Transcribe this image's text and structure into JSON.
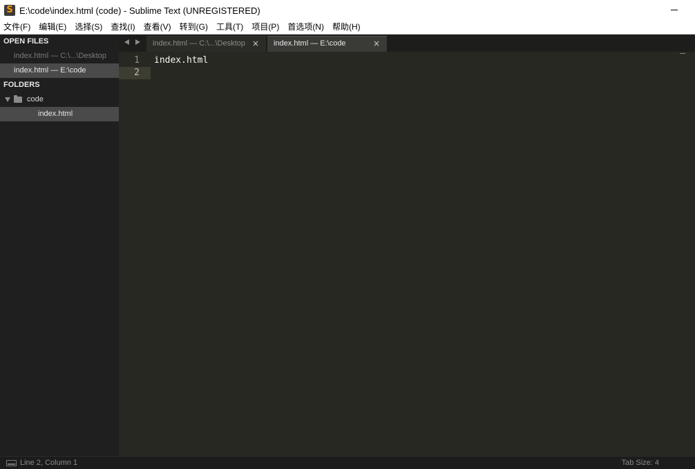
{
  "window": {
    "title": "E:\\code\\index.html (code) - Sublime Text (UNREGISTERED)",
    "icon": "sublime-text-icon"
  },
  "menu": [
    {
      "label": "文件(F)"
    },
    {
      "label": "编辑(E)"
    },
    {
      "label": "选择(S)"
    },
    {
      "label": "查找(I)"
    },
    {
      "label": "查看(V)"
    },
    {
      "label": "转到(G)"
    },
    {
      "label": "工具(T)"
    },
    {
      "label": "项目(P)"
    },
    {
      "label": "首选项(N)"
    },
    {
      "label": "帮助(H)"
    }
  ],
  "sidebar": {
    "open_files_header": "OPEN FILES",
    "open_files": [
      {
        "label": "index.html — C:\\...\\Desktop",
        "active": false
      },
      {
        "label": "index.html — E:\\code",
        "active": true
      }
    ],
    "folders_header": "FOLDERS",
    "folder": {
      "name": "code",
      "expanded": true
    },
    "folder_files": [
      {
        "label": "index.html",
        "selected": true
      }
    ]
  },
  "tabs": [
    {
      "label": "index.html — C:\\...\\Desktop",
      "active": false,
      "close": "×"
    },
    {
      "label": "index.html — E:\\code",
      "active": true,
      "close": "×"
    }
  ],
  "editor": {
    "lines": [
      {
        "number": "1",
        "text": "index.html"
      },
      {
        "number": "2",
        "text": ""
      }
    ],
    "current_line": 2
  },
  "statusbar": {
    "position": "Line 2, Column 1",
    "tab_size": "Tab Size: 4"
  },
  "colors": {
    "editor_bg": "#272822",
    "sidebar_bg": "#1f1f1f",
    "icon_accent": "#ff9800"
  }
}
